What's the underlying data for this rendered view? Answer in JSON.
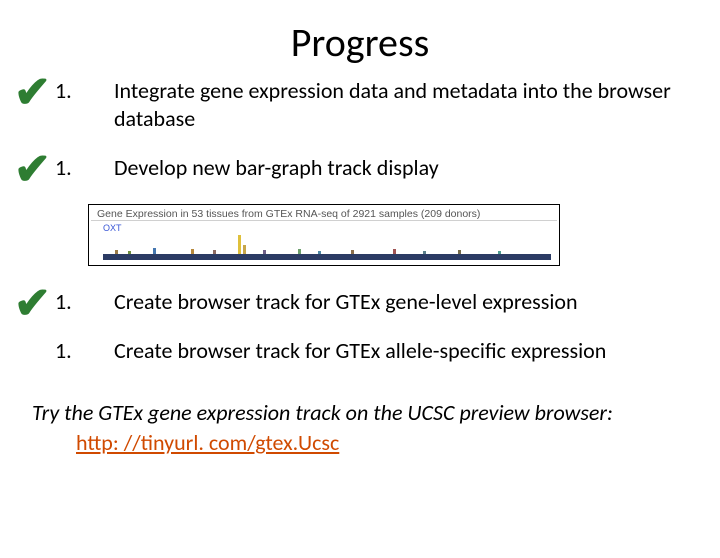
{
  "title": "Progress",
  "items": [
    {
      "num": "1.",
      "text": "Integrate gene expression data and metadata into the browser database",
      "done": true
    },
    {
      "num": "1.",
      "text": "Develop new bar-graph track display",
      "done": true
    },
    {
      "num": "1.",
      "text": "Create browser track for GTEx gene-level expression",
      "done": true
    },
    {
      "num": "1.",
      "text": "Create browser track for GTEx allele-specific expression",
      "done": false
    }
  ],
  "figure": {
    "title": "Gene Expression in 53 tissues from GTEx RNA-seq of 2921 samples (209 donors)",
    "gene_label": "OXT"
  },
  "note": {
    "line": "Try the GTEx gene expression track on the UCSC preview browser:",
    "link_text": "http: //tinyurl. com/gtex.Ucsc"
  },
  "check_glyph": "✔"
}
